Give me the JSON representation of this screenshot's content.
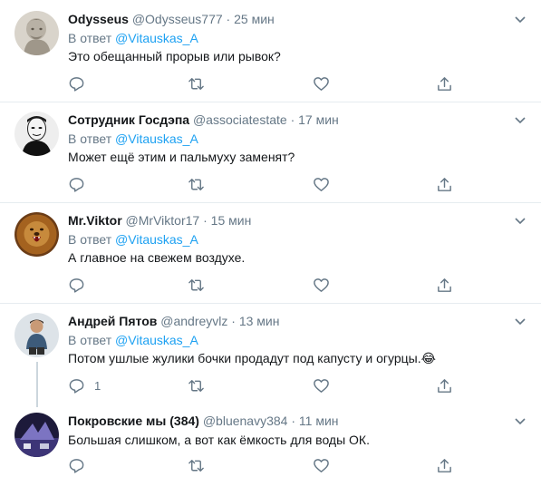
{
  "tweets": [
    {
      "name": "Odysseus",
      "handle": "@Odysseus777",
      "separator": "·",
      "time": "25 мин",
      "reply_prefix": "В ответ ",
      "reply_to": "@Vitauskas_A",
      "text": "Это обещанный прорыв или рывок?",
      "reply_count": ""
    },
    {
      "name": "Сотрудник Госдэпа",
      "handle": "@associatestate",
      "separator": "·",
      "time": "17 мин",
      "reply_prefix": "В ответ ",
      "reply_to": "@Vitauskas_A",
      "text": "Может ещё этим и пальмуху заменят?",
      "reply_count": ""
    },
    {
      "name": "Mr.Viktor",
      "handle": "@MrViktor17",
      "separator": "·",
      "time": "15 мин",
      "reply_prefix": "В ответ ",
      "reply_to": "@Vitauskas_A",
      "text": "А главное на свежем воздухе.",
      "reply_count": ""
    },
    {
      "name": "Андрей Пятов",
      "handle": "@andreyvlz",
      "separator": "·",
      "time": "13 мин",
      "reply_prefix": "В ответ ",
      "reply_to": "@Vitauskas_A",
      "text": "Потом ушлые жулики бочки продадут под капусту и огурцы.😂",
      "reply_count": "1"
    },
    {
      "name": "Покровские мы (384)",
      "handle": "@bluenavy384",
      "separator": "·",
      "time": "11 мин",
      "text": "Большая слишком, а вот как ёмкость для воды ОК."
    }
  ],
  "icons": {
    "reply": "reply-icon",
    "retweet": "retweet-icon",
    "like": "like-icon",
    "share": "share-icon",
    "more": "chevron-down-icon"
  },
  "colors": {
    "accent": "#1da1f2",
    "secondary_text": "#657786",
    "divider": "#e6ecf0",
    "thread_line": "#ccd6dd"
  }
}
